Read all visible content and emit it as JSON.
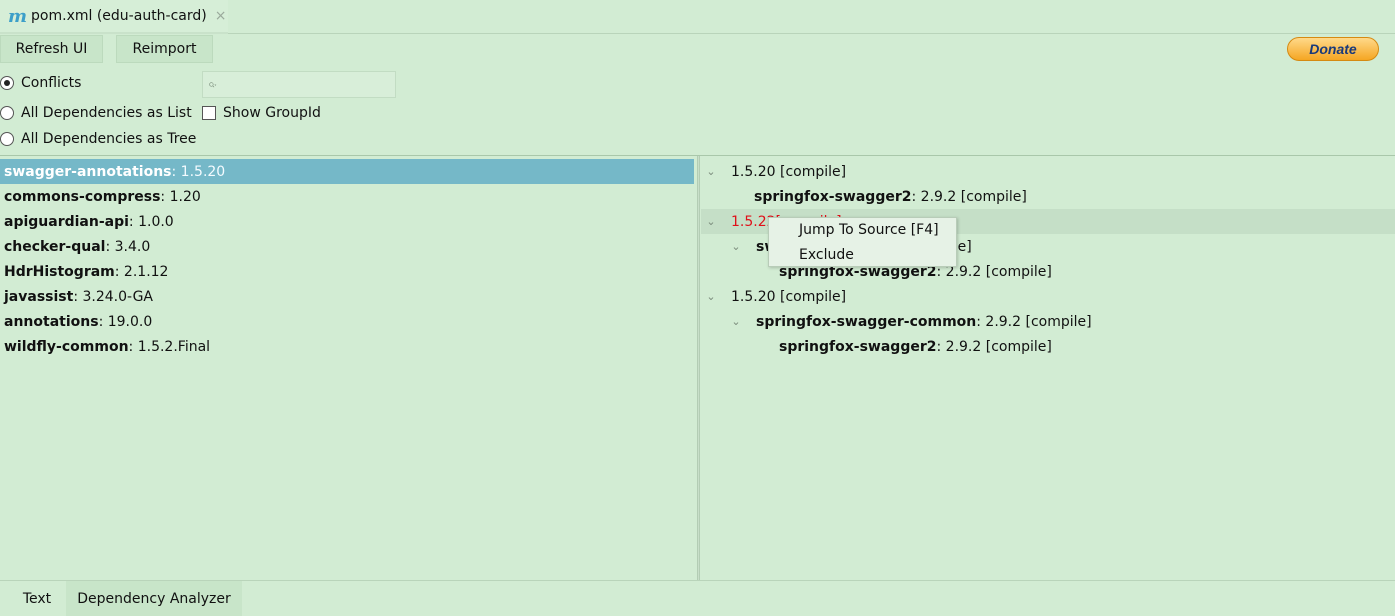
{
  "editor_tab": {
    "icon": "m",
    "title": "pom.xml (edu-auth-card)",
    "close": "×"
  },
  "toolbar": {
    "refresh_label": "Refresh UI",
    "reimport_label": "Reimport",
    "donate_label": "Donate"
  },
  "options": {
    "conflicts": "Conflicts",
    "all_list": "All Dependencies as List",
    "all_tree": "All Dependencies as Tree",
    "show_groupid": "Show GroupId",
    "selected": "conflicts",
    "show_groupid_checked": false,
    "search_placeholder": ""
  },
  "left_list": [
    {
      "name": "swagger-annotations",
      "version": " : 1.5.20",
      "selected": true
    },
    {
      "name": "commons-compress",
      "version": " : 1.20"
    },
    {
      "name": "apiguardian-api",
      "version": " : 1.0.0"
    },
    {
      "name": "checker-qual",
      "version": " : 3.4.0"
    },
    {
      "name": "HdrHistogram",
      "version": " : 2.1.12"
    },
    {
      "name": "javassist",
      "version": " : 3.24.0-GA"
    },
    {
      "name": "annotations",
      "version": " : 19.0.0"
    },
    {
      "name": "wildfly-common",
      "version": " : 1.5.2.Final"
    }
  ],
  "right_tree": [
    {
      "depth": 0,
      "expander": true,
      "text": "1.5.20 [compile]"
    },
    {
      "depth": 1,
      "expander": false,
      "name": "springfox-swagger2",
      "rest": " : 2.9.2 [compile]"
    },
    {
      "depth": 0,
      "expander": true,
      "text_red": "1.5.22",
      "text_red2": " [compile]",
      "highlight": true
    },
    {
      "depth": 1,
      "expander": true,
      "name": "sw",
      "rest": "pile]"
    },
    {
      "depth": 2,
      "expander": false,
      "name": "springfox-swagger2",
      "rest": " : 2.9.2 [compile]"
    },
    {
      "depth": 0,
      "expander": true,
      "text": "1.5.20 [compile]"
    },
    {
      "depth": 1,
      "expander": true,
      "name": "springfox-swagger-common",
      "rest": " : 2.9.2 [compile]"
    },
    {
      "depth": 2,
      "expander": false,
      "name": "springfox-swagger2",
      "rest": " : 2.9.2 [compile]"
    }
  ],
  "context_menu": {
    "jump": "Jump To Source [F4]",
    "exclude": "Exclude"
  },
  "bottom_tabs": {
    "text": "Text",
    "dependency_analyzer": "Dependency Analyzer"
  }
}
